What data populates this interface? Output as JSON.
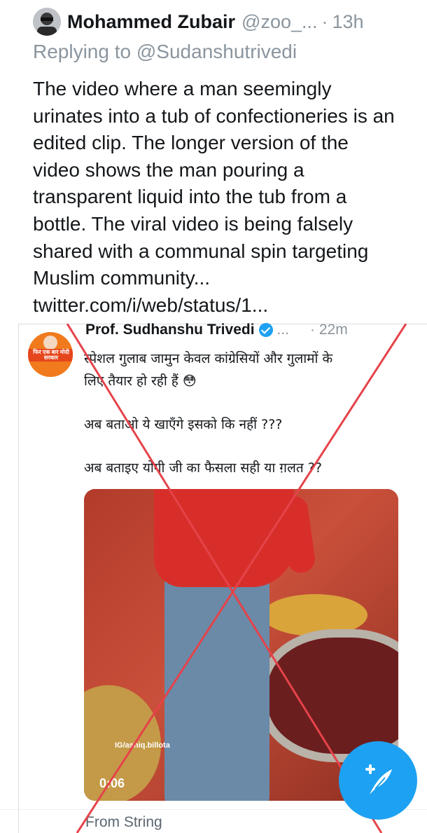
{
  "tweet": {
    "author_name": "Mohammed Zubair",
    "author_handle": "@zoo_...",
    "separator": "·",
    "time": "13h",
    "replying_to_label": "Replying to",
    "replying_to_handle": "@Sudanshutrivedi",
    "text": "The video where a man seemingly urinates into a tub of confectioneries is an edited clip. The longer version of the video shows the man pouring a transparent liquid into the tub from a bottle. The viral video is being falsely shared with a communal spin targeting Muslim community...",
    "link": "twitter.com/i/web/status/1..."
  },
  "embedded_tweet": {
    "author_name": "Prof. Sudhanshu Trivedi",
    "more": "...",
    "time": "· 22m",
    "avatar_text": "फिर एक बार मोदी सरकार",
    "line1": "स्पेशल गुलाब जामुन केवल कांग्रेसियों और गुलामों के",
    "line2": "लिए तैयार हो रही हैं 😳",
    "line3": "अब बताओ ये खाएँगे इसको कि नहीं ???",
    "line4": "अब बताइए योगी जी का फैसला सही या ग़लत ??",
    "media_watermark": "IG/ashiq.billota",
    "media_duration": "0:06",
    "source": "From String"
  },
  "colors": {
    "accent": "#1da1f2",
    "cross": "#e5434a",
    "secondary_text": "#8b959e"
  },
  "icons": {
    "fab": "compose-tweet-feather-icon",
    "verified": "verified-badge-icon"
  }
}
